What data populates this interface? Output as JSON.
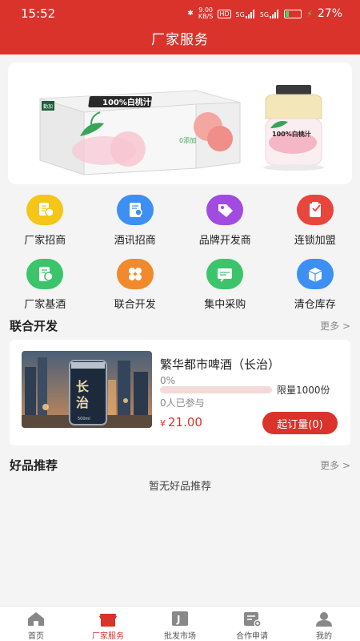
{
  "status_bar": {
    "time": "15:52",
    "network_speed": "9.00",
    "network_unit": "KB/S",
    "hd": "HD",
    "signal_1": "5G",
    "signal_2": "5G",
    "battery": "27%",
    "battery_level": 0.27
  },
  "header": {
    "title": "厂家服务"
  },
  "banner": {
    "box_text": "100%白桃汁",
    "bottle_text": "100%白桃汁",
    "box_brand": "勤加",
    "side_text": "0添加"
  },
  "menu": [
    {
      "label": "厂家招商",
      "icon": "factory-investment-icon",
      "color": "#f5c518"
    },
    {
      "label": "酒讯招商",
      "icon": "wine-news-icon",
      "color": "#3d8ff3"
    },
    {
      "label": "品牌开发商",
      "icon": "brand-tag-icon",
      "color": "#a24be0"
    },
    {
      "label": "连锁加盟",
      "icon": "chain-franchise-icon",
      "color": "#e8453c"
    },
    {
      "label": "厂家基酒",
      "icon": "base-liquor-icon",
      "color": "#3cc46b"
    },
    {
      "label": "联合开发",
      "icon": "joint-dev-icon",
      "color": "#f08a2c"
    },
    {
      "label": "集中采购",
      "icon": "group-purchase-icon",
      "color": "#3cc46b"
    },
    {
      "label": "清仓库存",
      "icon": "clearance-box-icon",
      "color": "#3d8ff3"
    }
  ],
  "joint_dev": {
    "title": "联合开发",
    "more": "更多 >",
    "product": {
      "name": "繁华都市啤酒（长治）",
      "progress_text": "0%",
      "progress": 0,
      "limit": "限量1000份",
      "joined": "0人已参与",
      "currency": "¥",
      "price": "21.00",
      "order_button": "起订量(0)",
      "can_text": "长治",
      "can_size": "500ml"
    }
  },
  "recommend": {
    "title": "好品推荐",
    "more": "更多 >",
    "empty": "暂无好品推荐"
  },
  "tabs": [
    {
      "label": "首页",
      "icon": "home-icon",
      "active": false
    },
    {
      "label": "厂家服务",
      "icon": "shop-icon",
      "active": true
    },
    {
      "label": "批发市场",
      "icon": "wholesale-icon",
      "active": false
    },
    {
      "label": "合作申请",
      "icon": "cooperation-apply-icon",
      "active": false
    },
    {
      "label": "我的",
      "icon": "user-icon",
      "active": false
    }
  ],
  "colors": {
    "primary": "#d9332b",
    "background": "#f4f4f4"
  }
}
